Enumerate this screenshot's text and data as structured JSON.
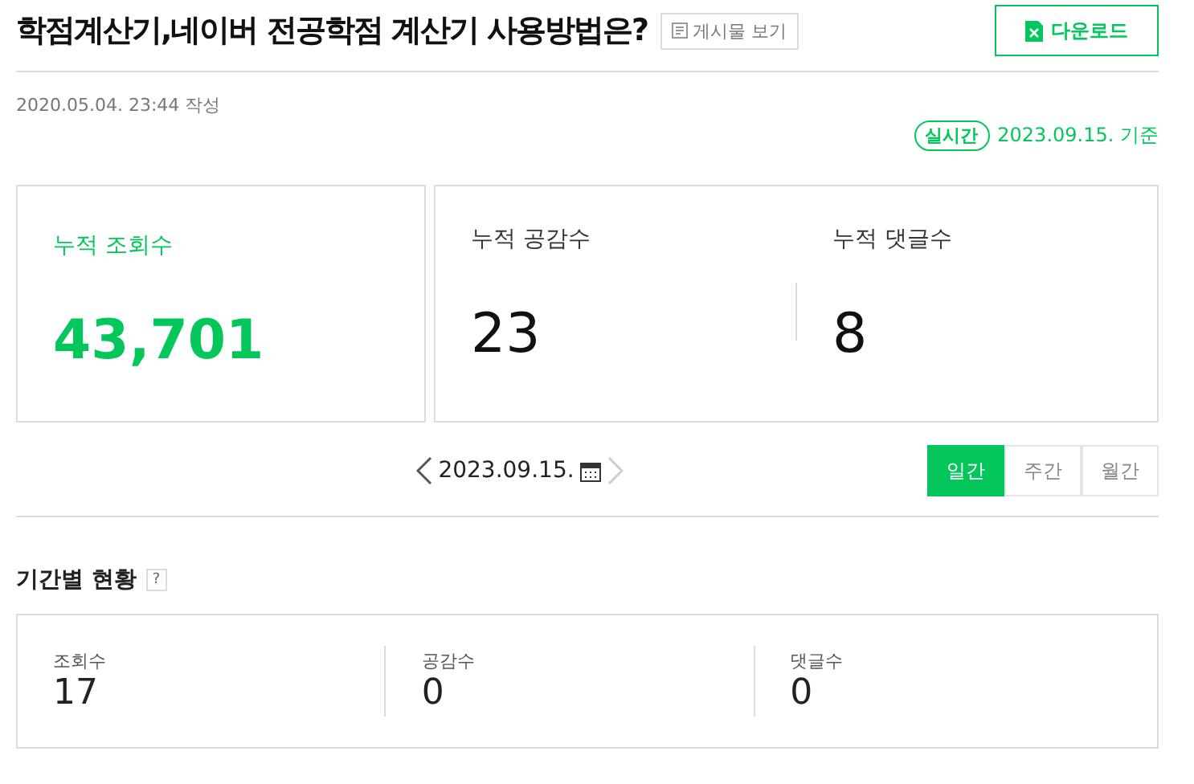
{
  "header": {
    "title": "학점계산기,네이버 전공학점 계산기 사용방법은?",
    "view_post_button": "게시물 보기",
    "download_button": "다운로드"
  },
  "written": "2020.05.04. 23:44 작성",
  "basis": {
    "badge": "실시간",
    "date": "2023.09.15. 기준"
  },
  "totals": [
    {
      "label": "누적 조회수",
      "value": "43,701",
      "kind": "highlight"
    },
    {
      "label": "누적 공감수",
      "value": "23",
      "kind": "plain"
    },
    {
      "label": "누적 댓글수",
      "value": "8",
      "kind": "plain"
    }
  ],
  "date_nav": {
    "date": "2023.09.15.",
    "next_disabled": true
  },
  "period_tabs": [
    {
      "label": "일간",
      "selected": true
    },
    {
      "label": "주간",
      "selected": false
    },
    {
      "label": "월간",
      "selected": false
    }
  ],
  "period_section": {
    "title": "기간별 현황",
    "help": "?",
    "stats": [
      {
        "label": "조회수",
        "value": "17"
      },
      {
        "label": "공감수",
        "value": "0"
      },
      {
        "label": "댓글수",
        "value": "0"
      }
    ]
  }
}
